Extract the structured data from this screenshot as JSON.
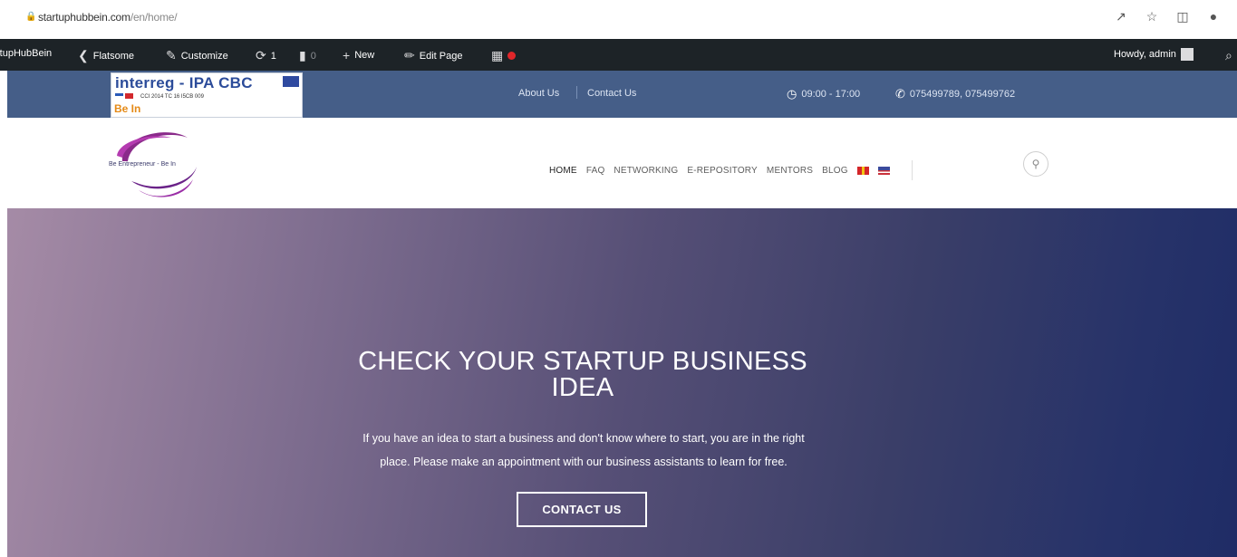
{
  "browser": {
    "url_host": "startuphubbein.com",
    "url_path": "/en/home/"
  },
  "adminbar": {
    "site_name": "rtupHubBein",
    "theme": "Flatsome",
    "customize": "Customize",
    "updates_count": "1",
    "comments_count": "0",
    "new": "New",
    "edit_page": "Edit Page",
    "greeting": "Howdy, admin"
  },
  "badge": {
    "title": "interreg - IPA CBC",
    "cci": "CCI 2014 TC 16 I5CB 009",
    "bein": "Be In"
  },
  "topbar": {
    "links": [
      "About Us",
      "Contact Us"
    ],
    "hours": "09:00 - 17:00",
    "phones": "075499789, 075499762",
    "bg_color": "#455e88"
  },
  "header": {
    "logo_text": "Be Entrepreneur - Be In",
    "nav": [
      "HOME",
      "FAQ",
      "NETWORKING",
      "E-REPOSITORY",
      "MENTORS",
      "BLOG"
    ]
  },
  "hero": {
    "title_line1": "CHECK YOUR STARTUP BUSINESS",
    "title_line2": "IDEA",
    "text_line1": "If you have an idea to start a business and don't know where to start, you are in the right",
    "text_line2": "place. Please make an appointment with our business assistants to learn for free.",
    "cta": "CONTACT US"
  }
}
